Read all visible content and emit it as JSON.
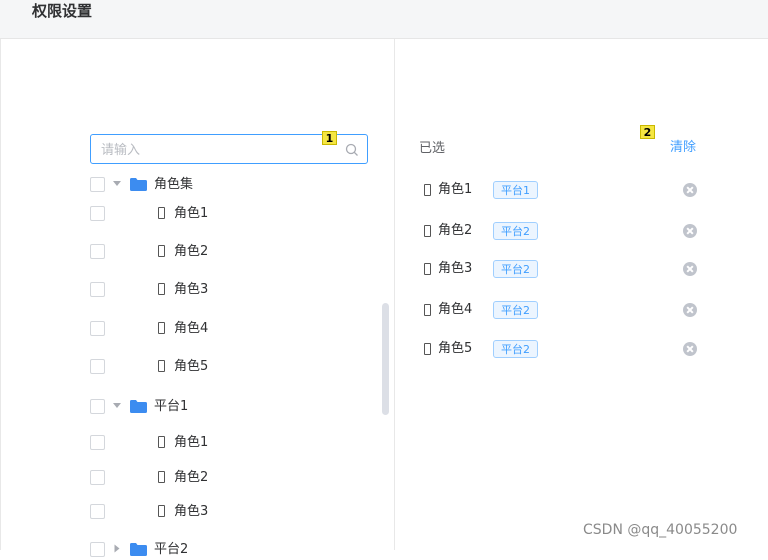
{
  "header": {
    "title": "权限设置"
  },
  "search": {
    "placeholder": "请输入",
    "value": ""
  },
  "markers": {
    "search": "1",
    "selected": "2"
  },
  "tree": {
    "nodes": [
      {
        "label": "角色集",
        "type": "folder",
        "expanded": true
      },
      {
        "label": "角色1",
        "type": "leaf"
      },
      {
        "label": "角色2",
        "type": "leaf"
      },
      {
        "label": "角色3",
        "type": "leaf"
      },
      {
        "label": "角色4",
        "type": "leaf"
      },
      {
        "label": "角色5",
        "type": "leaf"
      },
      {
        "label": "平台1",
        "type": "folder",
        "expanded": true
      },
      {
        "label": "角色1",
        "type": "leaf"
      },
      {
        "label": "角色2",
        "type": "leaf"
      },
      {
        "label": "角色3",
        "type": "leaf"
      },
      {
        "label": "平台2",
        "type": "folder",
        "expanded": false
      }
    ]
  },
  "selected": {
    "title": "已选",
    "clear_label": "清除",
    "items": [
      {
        "label": "角色1",
        "tag": "平台1"
      },
      {
        "label": "角色2",
        "tag": "平台2"
      },
      {
        "label": "角色3",
        "tag": "平台2"
      },
      {
        "label": "角色4",
        "tag": "平台2"
      },
      {
        "label": "角色5",
        "tag": "平台2"
      }
    ]
  },
  "watermark": "CSDN @qq_40055200",
  "colors": {
    "accent": "#409eff",
    "folder": "#3c8cf0",
    "tag_bg": "#ecf5ff"
  }
}
